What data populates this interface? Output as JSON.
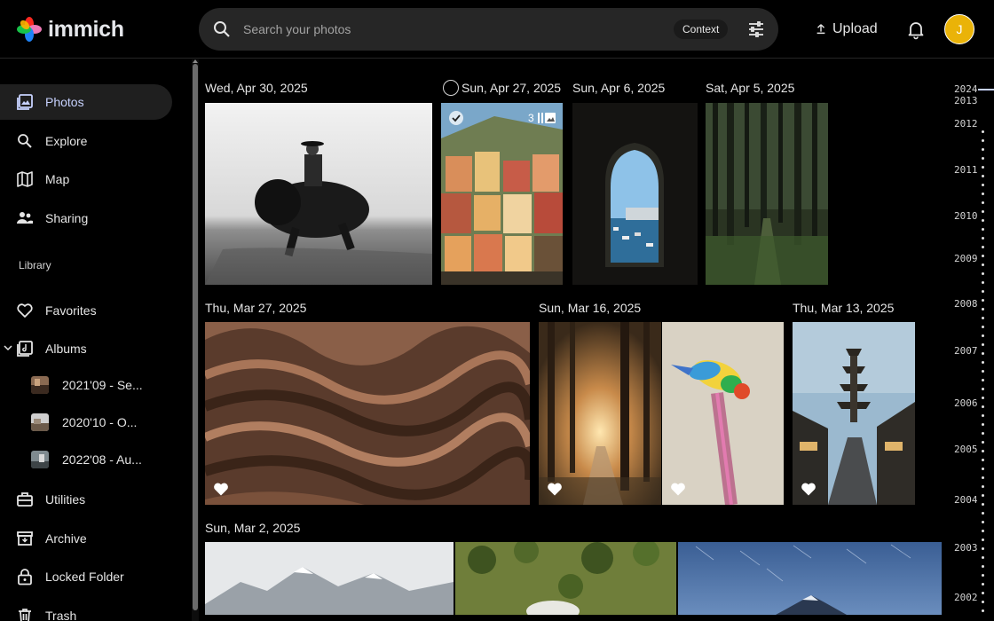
{
  "brand": {
    "name": "immich"
  },
  "search": {
    "placeholder": "Search your photos",
    "context_label": "Context"
  },
  "header": {
    "upload_label": "Upload",
    "avatar_initial": "J"
  },
  "sidebar": {
    "nav": [
      {
        "label": "Photos",
        "icon": "photos-icon",
        "active": true
      },
      {
        "label": "Explore",
        "icon": "search-icon"
      },
      {
        "label": "Map",
        "icon": "map-icon"
      },
      {
        "label": "Sharing",
        "icon": "sharing-icon"
      }
    ],
    "library_label": "Library",
    "library": [
      {
        "label": "Favorites",
        "icon": "heart-icon"
      },
      {
        "label": "Albums",
        "icon": "album-icon"
      }
    ],
    "albums": [
      {
        "label": "2021'09 - Se..."
      },
      {
        "label": "2020'10 - O..."
      },
      {
        "label": "2022'08 - Au..."
      }
    ],
    "tools": [
      {
        "label": "Utilities",
        "icon": "toolbox-icon"
      },
      {
        "label": "Archive",
        "icon": "archive-icon"
      },
      {
        "label": "Locked Folder",
        "icon": "lock-icon"
      },
      {
        "label": "Trash",
        "icon": "trash-icon"
      }
    ]
  },
  "timeline": {
    "groups": [
      {
        "date": "Wed, Apr 30, 2025"
      },
      {
        "date": "Sun, Apr 27, 2025"
      },
      {
        "date": "Sun, Apr 6, 2025"
      },
      {
        "date": "Sat, Apr 5, 2025"
      },
      {
        "date": "Thu, Mar 27, 2025"
      },
      {
        "date": "Sun, Mar 16, 2025"
      },
      {
        "date": "Thu, Mar 13, 2025"
      },
      {
        "date": "Sun, Mar 2, 2025"
      }
    ],
    "stack_count": "3"
  },
  "scrubber": {
    "years": [
      "2024",
      "2013",
      "2012",
      "2011",
      "2010",
      "2009",
      "2008",
      "2007",
      "2006",
      "2005",
      "2004",
      "2003",
      "2002"
    ]
  },
  "colors": {
    "accent": "#c7d2fe",
    "avatar": "#eab308",
    "background": "#000000"
  }
}
